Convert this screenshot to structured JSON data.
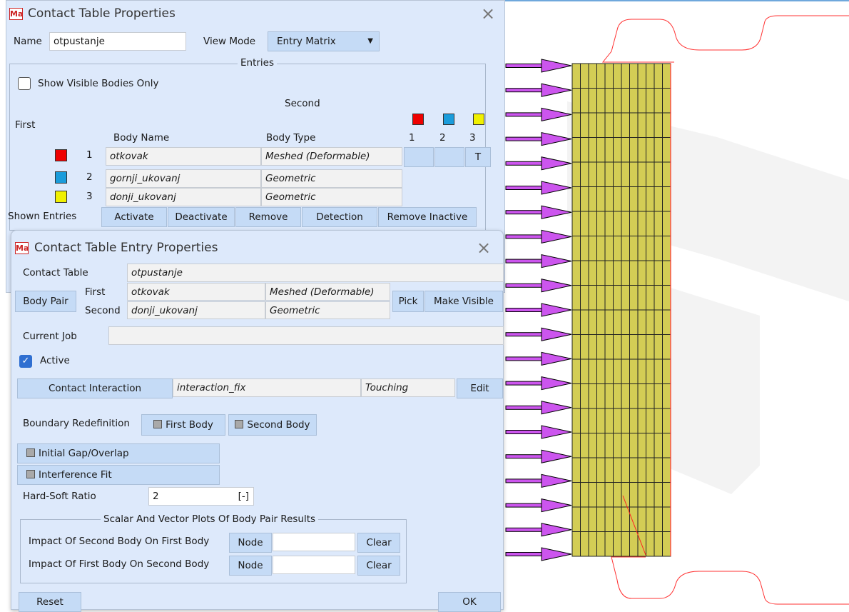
{
  "colors": {
    "red": "#ee0000",
    "blue": "#1a9cdb",
    "yellow": "#f0f000",
    "arrow": "#cc55ee",
    "mesh": "#d3cd55",
    "contour": "#ff3333"
  },
  "table_dialog": {
    "title": "Contact Table Properties",
    "logo": "Ma",
    "name_label": "Name",
    "name_value": "otpustanje",
    "view_mode_label": "View Mode",
    "view_mode_value": "Entry Matrix",
    "entries_legend": "Entries",
    "show_visible_label": "Show Visible Bodies Only",
    "second_label": "Second",
    "first_label": "First",
    "col_body_name": "Body Name",
    "col_body_type": "Body Type",
    "col_numbers": [
      "1",
      "2",
      "3"
    ],
    "rows": [
      {
        "num": "1",
        "name": "otkovak",
        "type": "Meshed (Deformable)"
      },
      {
        "num": "2",
        "name": "gornji_ukovanj",
        "type": "Geometric"
      },
      {
        "num": "3",
        "name": "donji_ukovanj",
        "type": "Geometric"
      }
    ],
    "matrix_t": "T",
    "shown_entries_label": "Shown Entries",
    "buttons": {
      "activate": "Activate",
      "deactivate": "Deactivate",
      "remove": "Remove",
      "detection": "Detection",
      "remove_inactive": "Remove Inactive"
    }
  },
  "entry_dialog": {
    "title": "Contact Table Entry Properties",
    "logo": "Ma",
    "contact_table_label": "Contact Table",
    "contact_table_value": "otpustanje",
    "body_pair_button": "Body Pair",
    "first_label": "First",
    "second_label": "Second",
    "first_name": "otkovak",
    "first_type": "Meshed (Deformable)",
    "second_name": "donji_ukovanj",
    "second_type": "Geometric",
    "pick_button": "Pick",
    "make_visible_button": "Make Visible",
    "current_job_label": "Current Job",
    "current_job_value": "",
    "active_label": "Active",
    "contact_interaction_button": "Contact Interaction",
    "interaction_name": "interaction_fix",
    "interaction_type": "Touching",
    "edit_button": "Edit",
    "boundary_label": "Boundary Redefinition",
    "first_body_button": "First Body",
    "second_body_button": "Second Body",
    "initial_gap_button": "Initial Gap/Overlap",
    "interference_fit_button": "Interference Fit",
    "hard_soft_label": "Hard-Soft Ratio",
    "hard_soft_value": "2",
    "hard_soft_unit": "[-]",
    "plots_legend": "Scalar And Vector Plots Of Body Pair Results",
    "impact_second_label": "Impact Of Second Body On First Body",
    "impact_first_label": "Impact Of First Body On Second Body",
    "node_button": "Node",
    "clear_button": "Clear",
    "reset_button": "Reset",
    "ok_button": "OK"
  }
}
